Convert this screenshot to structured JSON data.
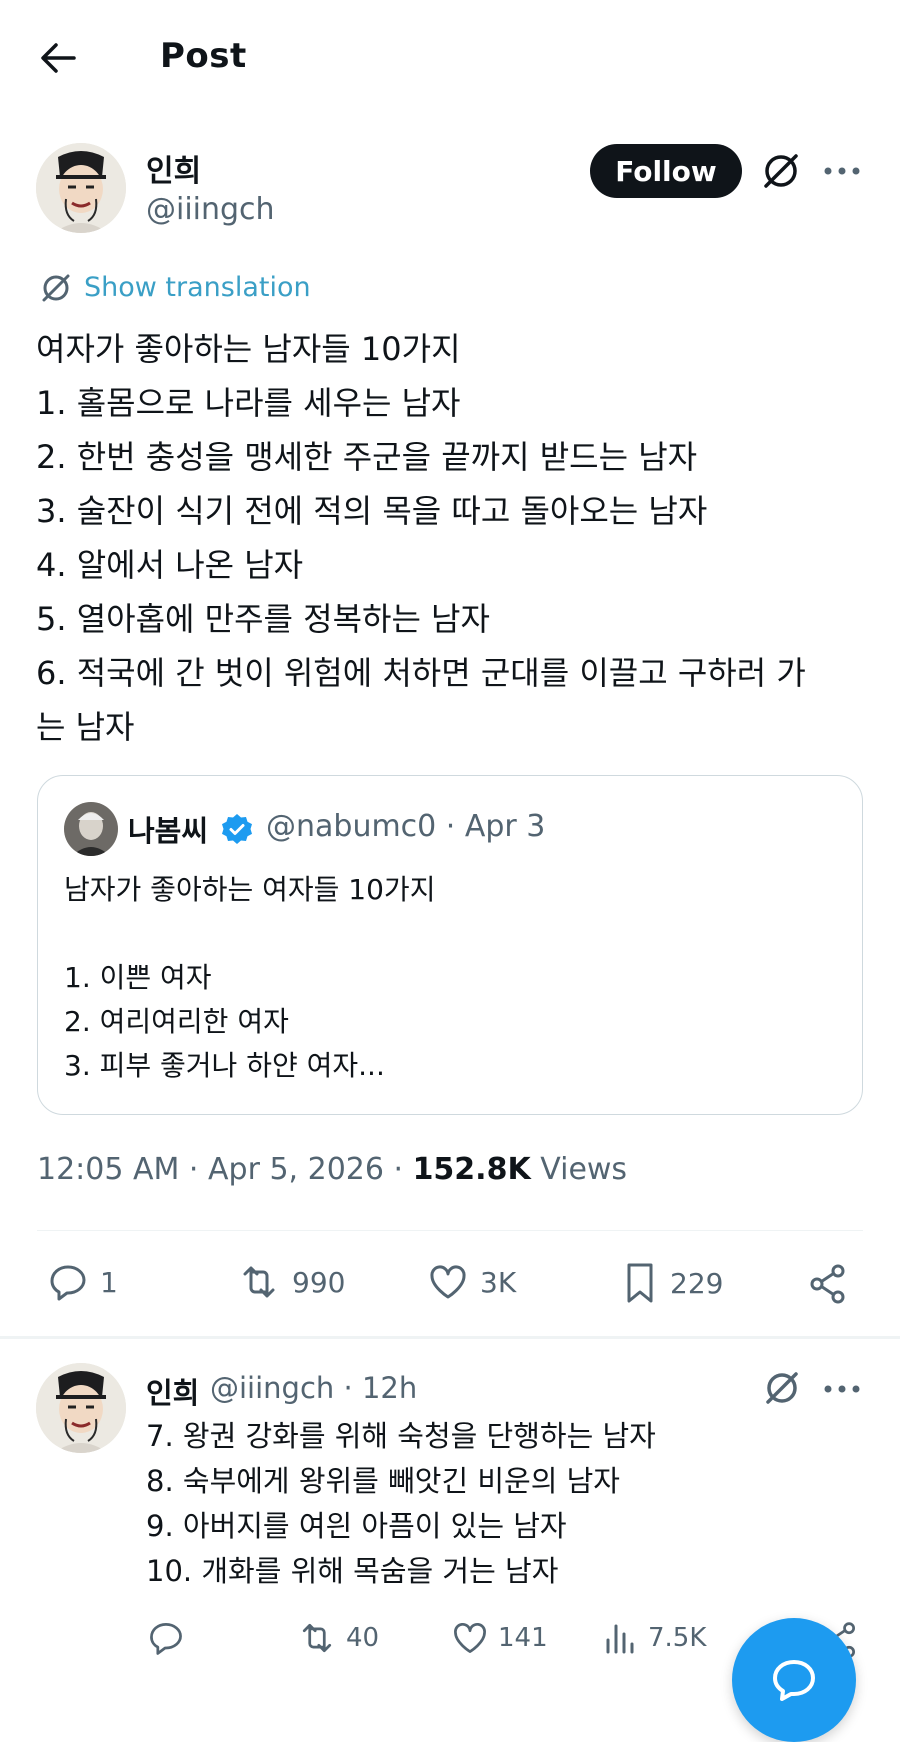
{
  "header": {
    "title": "Post"
  },
  "author": {
    "name": "인희",
    "handle": "@iiingch"
  },
  "follow_label": "Follow",
  "show_translation": "Show translation",
  "tweet_lines": [
    "여자가 좋아하는 남자들 10가지",
    "1. 홀몸으로 나라를 세우는 남자",
    "2. 한번 충성을 맹세한 주군을 끝까지 받드는 남자",
    "3. 술잔이 식기 전에 적의 목을 따고 돌아오는 남자",
    "4. 알에서 나온 남자",
    "5. 열아홉에 만주를 정복하는 남자",
    "6. 적국에 간 벗이 위험에 처하면 군대를 이끌고 구하러 가",
    "는 남자"
  ],
  "quote": {
    "name": "나봄씨",
    "handle_date": "@nabumc0 · Apr 3",
    "lines": [
      "남자가 좋아하는 여자들 10가지",
      "",
      "1. 이쁜 여자",
      "2. 여리여리한 여자",
      "3. 피부 좋거나 하얀 여자..."
    ]
  },
  "meta": {
    "timestamp": "12:05 AM · Apr 5, 2026 · ",
    "views_count": "152.8K",
    "views_label": " Views"
  },
  "actions": {
    "replies": "1",
    "reposts": "990",
    "likes": "3K",
    "bookmarks": "229"
  },
  "reply": {
    "name": "인희",
    "handle_time": "@iiingch · 12h",
    "lines": [
      "7. 왕권 강화를 위해 숙청을 단행하는 남자",
      "8. 숙부에게 왕위를 빼앗긴 비운의 남자",
      "9. 아버지를 여읜 아픔이 있는 남자",
      "10. 개화를 위해 목숨을 거는 남자"
    ],
    "actions": {
      "replies": "",
      "reposts": "40",
      "likes": "141",
      "views": "7.5K"
    }
  },
  "colors": {
    "text": "#0f1419",
    "secondary": "#536471",
    "accent": "#1d9bf0",
    "divider": "#eff3f4"
  }
}
